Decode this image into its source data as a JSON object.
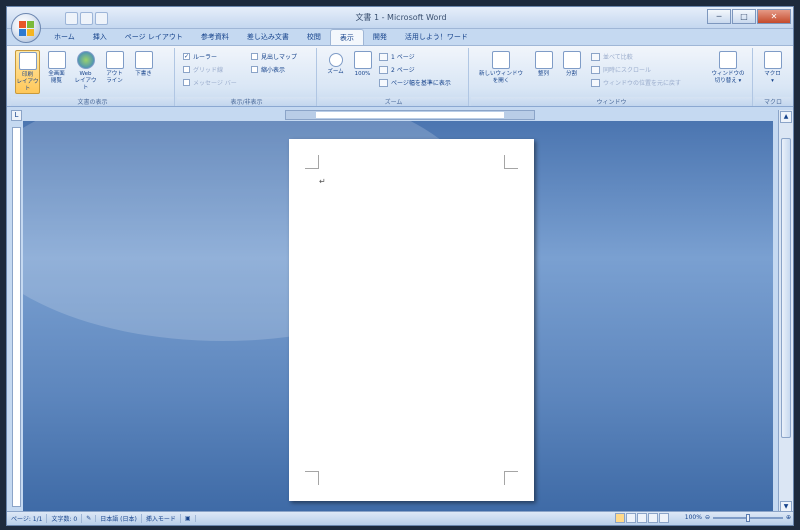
{
  "window": {
    "title": "文書 1 - Microsoft Word",
    "controls": {
      "minimize": "─",
      "maximize": "□",
      "close": "✕"
    }
  },
  "tabs": [
    {
      "label": "ホーム"
    },
    {
      "label": "挿入"
    },
    {
      "label": "ページ レイアウト"
    },
    {
      "label": "参考資料"
    },
    {
      "label": "差し込み文書"
    },
    {
      "label": "校閲"
    },
    {
      "label": "表示",
      "active": true
    },
    {
      "label": "開発"
    },
    {
      "label": "活用しよう！ワード"
    }
  ],
  "ribbon": {
    "groups": {
      "views": {
        "label": "文書の表示",
        "buttons": [
          {
            "label": "印刷\nレイアウト",
            "icon": "print-layout-icon",
            "active": true
          },
          {
            "label": "全画面\n閲覧",
            "icon": "full-screen-reading-icon"
          },
          {
            "label": "Web\nレイアウト",
            "icon": "web-layout-icon"
          },
          {
            "label": "アウト\nライン",
            "icon": "outline-icon"
          },
          {
            "label": "下書き",
            "icon": "draft-icon"
          }
        ]
      },
      "show_hide": {
        "label": "表示/非表示",
        "col1": [
          {
            "label": "ルーラー",
            "checked": true
          },
          {
            "label": "グリッド線",
            "checked": false,
            "disabled": true
          },
          {
            "label": "メッセージ バー",
            "checked": false,
            "disabled": true
          }
        ],
        "col2": [
          {
            "label": "見出しマップ",
            "checked": false
          },
          {
            "label": "縮小表示",
            "checked": false
          }
        ]
      },
      "zoom": {
        "label": "ズーム",
        "zoom_label": "ズーム",
        "pct_label": "100%",
        "items": [
          {
            "label": "1 ページ"
          },
          {
            "label": "2 ページ"
          },
          {
            "label": "ページ幅を基準に表示"
          }
        ]
      },
      "window": {
        "label": "ウィンドウ",
        "new_window": "新しいウィンドウ\nを開く",
        "arrange": "整列",
        "split": "分割",
        "side_items": [
          {
            "label": "並べて比較",
            "disabled": true
          },
          {
            "label": "同時にスクロール",
            "disabled": true
          },
          {
            "label": "ウィンドウの位置を元に戻す",
            "disabled": true
          }
        ],
        "switch": "ウィンドウの\n切り替え ▾"
      },
      "macro": {
        "label": "マクロ",
        "button": "マクロ\n▾"
      }
    }
  },
  "ruler": {
    "corner": "L"
  },
  "statusbar": {
    "page": "ページ: 1/1",
    "words": "文字数: 0",
    "lang": "日本語 (日本)",
    "mode": "挿入モード",
    "zoom_pct": "100%"
  },
  "document": {
    "cursor": "↵"
  }
}
